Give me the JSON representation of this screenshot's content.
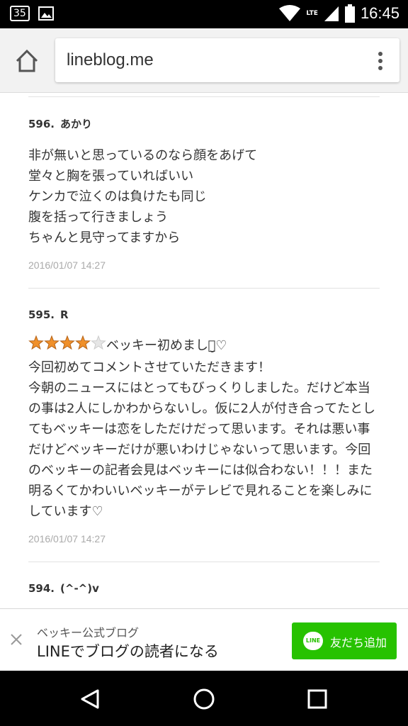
{
  "status_bar": {
    "notification_count": "35",
    "network": "LTE",
    "time": "16:45"
  },
  "browser": {
    "url": "lineblog.me",
    "icons": {
      "home": "home-icon",
      "menu": "more-vert-icon"
    }
  },
  "comments": [
    {
      "number": "596.",
      "author": "あかり",
      "body": "非が無いと思っているのなら顔をあげて\n堂々と胸を張っていればいい\nケンカで泣くのは負けたも同じ\n腹を括って行きましょう\nちゃんと見守ってますから",
      "date": "2016/01/07 14:27"
    },
    {
      "number": "595.",
      "author": "R",
      "rating": 4,
      "rating_max": 5,
      "body_after_stars": "ベッキー初めまして̮♡\n今回初めてコメントさせていただきます！\n今朝のニュースにはとってもびっくりしました。だけど本当の事は2人にしかわからないし。仮に2人が付き合ってたとしてもベッキーは恋をしただけだって思います。それは悪い事だけどベッキーだけが悪いわけじゃないって思います。今回のベッキーの記者会見はベッキーには似合わない！！！また明るくてかわいいベッキーがテレビで見れることを楽しみにしています♡",
      "date": "2016/01/07 14:27"
    },
    {
      "number": "594.",
      "author": "(^-^)v"
    }
  ],
  "banner": {
    "subtitle": "ベッキー公式ブログ",
    "title": "LINEでブログの読者になる",
    "button_logo": "LINE",
    "button_label": "友だち追加",
    "button_color": "#27c200"
  },
  "navbar": {
    "icons": [
      "back-icon",
      "home-circle-icon",
      "recents-icon"
    ]
  }
}
